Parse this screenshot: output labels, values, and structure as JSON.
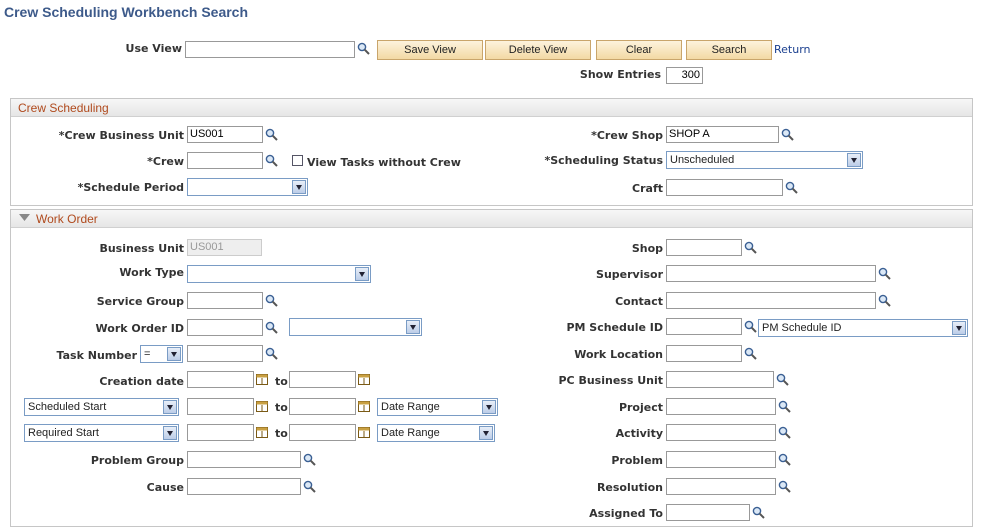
{
  "title": "Crew Scheduling Workbench Search",
  "top": {
    "use_view_label": "Use View",
    "use_view_value": "",
    "buttons": {
      "save_view": "Save View",
      "delete_view": "Delete View",
      "clear": "Clear",
      "search": "Search"
    },
    "return_link": "Return",
    "show_entries_label": "Show Entries",
    "show_entries_value": "300"
  },
  "crew_section": {
    "title": "Crew Scheduling",
    "crew_business_unit_label": "*Crew Business Unit",
    "crew_business_unit_value": "US001",
    "crew_label": "*Crew",
    "crew_value": "",
    "view_tasks_label": "View Tasks without Crew",
    "schedule_period_label": "*Schedule Period",
    "schedule_period_value": "",
    "crew_shop_label": "*Crew Shop",
    "crew_shop_value": "SHOP A",
    "scheduling_status_label": "*Scheduling Status",
    "scheduling_status_value": "Unscheduled",
    "craft_label": "Craft",
    "craft_value": ""
  },
  "work_order_section": {
    "title": "Work Order",
    "business_unit_label": "Business Unit",
    "business_unit_value": "US001",
    "work_type_label": "Work Type",
    "service_group_label": "Service Group",
    "work_order_id_label": "Work Order ID",
    "task_number_label": "Task Number",
    "task_number_operator": "=",
    "creation_date_label": "Creation date",
    "to_label": "to",
    "scheduled_start_option": "Scheduled Start",
    "required_start_option": "Required Start",
    "date_range_option": "Date Range",
    "problem_group_label": "Problem Group",
    "cause_label": "Cause",
    "shop_label": "Shop",
    "supervisor_label": "Supervisor",
    "contact_label": "Contact",
    "pm_schedule_id_label": "PM Schedule ID",
    "pm_schedule_option": "PM Schedule ID",
    "work_location_label": "Work Location",
    "pc_business_unit_label": "PC Business Unit",
    "project_label": "Project",
    "activity_label": "Activity",
    "problem_label": "Problem",
    "resolution_label": "Resolution",
    "assigned_to_label": "Assigned To"
  }
}
